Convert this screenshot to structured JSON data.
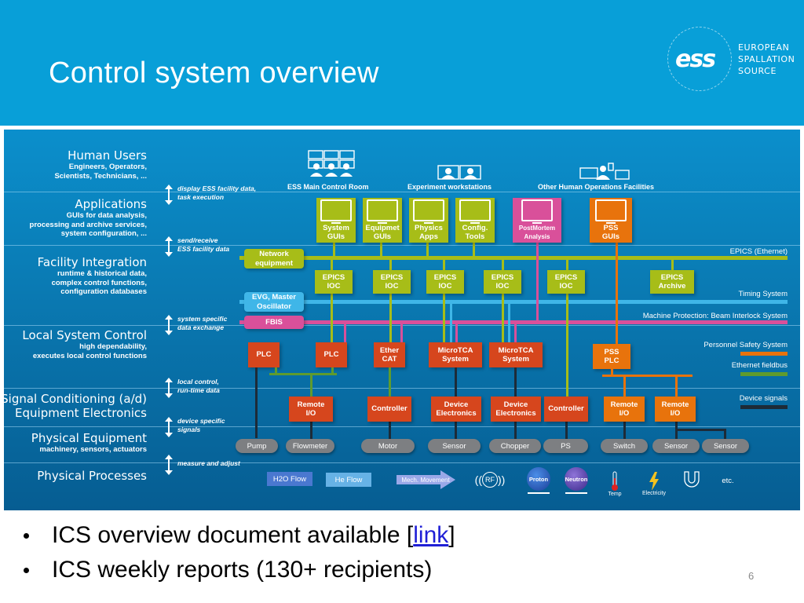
{
  "slide": {
    "title": "Control system overview",
    "logo": {
      "mark": "ess",
      "lines": [
        "EUROPEAN",
        "SPALLATION",
        "SOURCE"
      ]
    },
    "page_number": "6",
    "bullets": [
      {
        "text_before": "ICS overview document available [",
        "link": "link",
        "text_after": "]"
      },
      {
        "text_before": "ICS weekly reports (130+ recipients)",
        "link": "",
        "text_after": ""
      }
    ]
  },
  "diagram": {
    "layers": [
      {
        "title": "Human Users",
        "subtitle": [
          "Engineers, Operators,",
          "Scientists, Technicians, ..."
        ]
      },
      {
        "title": "Applications",
        "subtitle": [
          "GUIs for data analysis,",
          "processing and archive services,",
          "system configuration, ..."
        ]
      },
      {
        "title": "Facility Integration",
        "subtitle": [
          "runtime & historical data,",
          "complex control functions,",
          "configuration databases"
        ]
      },
      {
        "title": "Local System Control",
        "subtitle": [
          "high dependability,",
          "executes local control functions"
        ]
      },
      {
        "title": "Signal Conditioning (a/d)",
        "title2": "Equipment Electronics",
        "subtitle": []
      },
      {
        "title": "Physical Equipment",
        "subtitle": [
          "machinery, sensors, actuators"
        ]
      },
      {
        "title": "Physical Processes",
        "subtitle": []
      }
    ],
    "flows": [
      [
        "display ESS facility data,",
        "task execution"
      ],
      [
        "send/receive",
        "ESS facility data"
      ],
      [
        "system specific",
        "data exchange"
      ],
      [
        "local control,",
        "run-time data"
      ],
      [
        "device specific",
        "signals"
      ],
      [
        "measure and adjust"
      ]
    ],
    "user_groups": [
      "ESS Main Control Room",
      "Experiment workstations",
      "Other Human Operations Facilities"
    ],
    "applications": [
      {
        "label": [
          "System",
          "GUIs"
        ],
        "color": "#a7bd18"
      },
      {
        "label": [
          "Equipmet",
          "GUIs"
        ],
        "color": "#a7bd18"
      },
      {
        "label": [
          "Physics",
          "Apps"
        ],
        "color": "#a7bd18"
      },
      {
        "label": [
          "Config.",
          "Tools"
        ],
        "color": "#a7bd18"
      },
      {
        "label": [
          "PostMortem",
          "Analysis"
        ],
        "color": "#d9509a"
      },
      {
        "label": [
          "PSS",
          "GUIs"
        ],
        "color": "#e8730c"
      }
    ],
    "network_nodes": {
      "network_equipment": [
        "Network",
        "equipment"
      ],
      "evg": [
        "EVG, Master",
        "Oscillator"
      ],
      "fbis": "FBIS"
    },
    "iocs": [
      [
        "EPICS",
        "IOC"
      ],
      [
        "EPICS",
        "IOC"
      ],
      [
        "EPICS",
        "IOC"
      ],
      [
        "EPICS",
        "IOC"
      ],
      [
        "EPICS",
        "IOC"
      ],
      [
        "EPICS",
        "Archive"
      ]
    ],
    "controllers": [
      [
        "PLC"
      ],
      [
        "PLC"
      ],
      [
        "Ether",
        "CAT"
      ],
      [
        "MicroTCA",
        "System"
      ],
      [
        "MicroTCA",
        "System"
      ],
      [
        "PSS",
        "PLC"
      ]
    ],
    "electronics": [
      [
        "Remote",
        "I/O"
      ],
      [
        "Controller"
      ],
      [
        "Device",
        "Electronics"
      ],
      [
        "Device",
        "Electronics"
      ],
      [
        "Controller"
      ],
      [
        "Remote",
        "I/O"
      ],
      [
        "Remote",
        "I/O"
      ]
    ],
    "equipment": [
      "Pump",
      "Flowmeter",
      "Motor",
      "Sensor",
      "Chopper",
      "PS",
      "Switch",
      "Sensor",
      "Sensor"
    ],
    "processes": [
      "H2O Flow",
      "He Flow",
      "Mech. Movement",
      "RF",
      "Proton",
      "Neutron",
      "Temp",
      "Electricity",
      "etc."
    ],
    "legend": [
      {
        "label": "EPICS (Ethernet)",
        "color": "#a7bd18"
      },
      {
        "label": "Timing System",
        "color": "#3fb6e8"
      },
      {
        "label": "Machine Protection: Beam Interlock System",
        "color": "#d9509a"
      },
      {
        "label": "Personnel Safety System",
        "color": "#e8730c"
      },
      {
        "label": "Ethernet fieldbus",
        "color": "#5f9b2e"
      },
      {
        "label": "Device signals",
        "color": "#1d2b38"
      }
    ]
  }
}
